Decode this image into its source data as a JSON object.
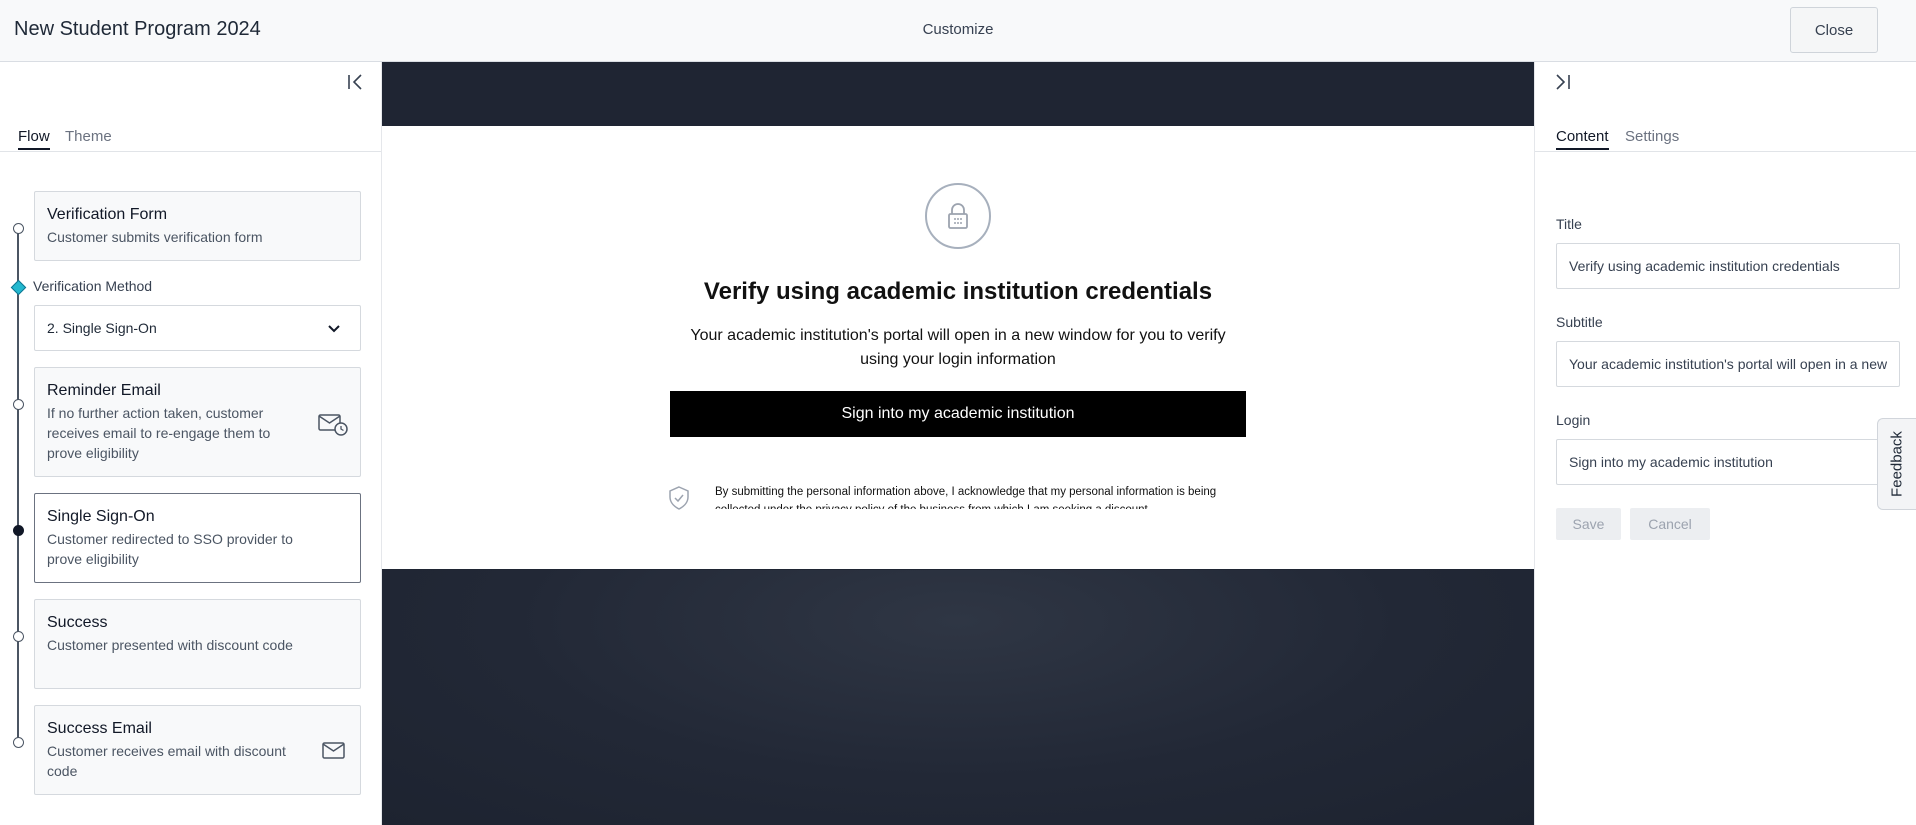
{
  "header": {
    "app_title": "New Student Program 2024",
    "center_title": "Customize",
    "close_label": "Close"
  },
  "left_panel": {
    "tabs": [
      {
        "label": "Flow",
        "active": true
      },
      {
        "label": "Theme",
        "active": false
      }
    ],
    "steps": [
      {
        "title": "Verification Form",
        "desc": "Customer submits verification form"
      },
      {
        "title": "Reminder Email",
        "desc": "If no further action taken, customer receives email to re-engage them to prove eligibility",
        "icon": "email-clock-icon"
      },
      {
        "title": "Single Sign-On",
        "desc": "Customer redirected to SSO provider to prove eligibility",
        "selected": true
      },
      {
        "title": "Success",
        "desc": "Customer presented with discount code"
      },
      {
        "title": "Success Email",
        "desc": "Customer receives email with discount code",
        "icon": "email-icon"
      }
    ],
    "method_label": "Verification Method",
    "method_value": "2. Single Sign-On"
  },
  "preview": {
    "title": "Verify using academic institution credentials",
    "subtitle": "Your academic institution's portal will open in a new window for you to verify using your login information",
    "button_label": "Sign into my academic institution",
    "consent": "By submitting the personal information above, I acknowledge that my personal information is being collected under the privacy policy of the business from which I am seeking a discount"
  },
  "right_panel": {
    "tabs": [
      {
        "label": "Content",
        "active": true
      },
      {
        "label": "Settings",
        "active": false
      }
    ],
    "fields": {
      "title_label": "Title",
      "title_value": "Verify using academic institution credentials",
      "subtitle_label": "Subtitle",
      "subtitle_value": "Your academic institution's portal will open in a new window for you to verify using your login information",
      "login_label": "Login",
      "login_value": "Sign into my academic institution"
    },
    "save_label": "Save",
    "cancel_label": "Cancel"
  },
  "feedback_label": "Feedback",
  "colors": {
    "preview_background": "#1f2533",
    "primary_button": "#000000",
    "method_marker": "#22b8cf"
  }
}
